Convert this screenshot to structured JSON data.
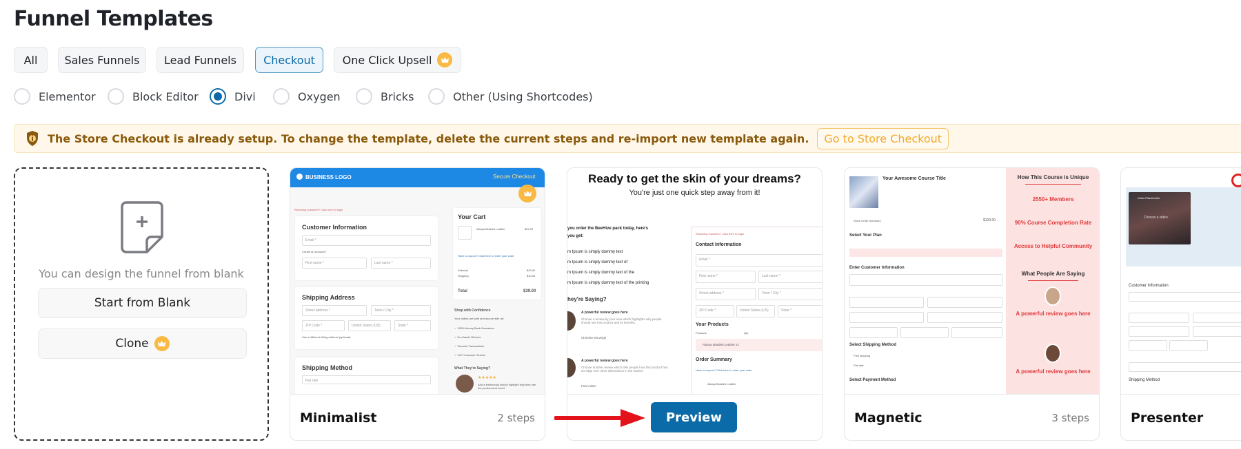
{
  "page_title": "Funnel Templates",
  "tabs": [
    {
      "label": "All"
    },
    {
      "label": "Sales Funnels"
    },
    {
      "label": "Lead Funnels"
    },
    {
      "label": "Checkout",
      "active": true
    },
    {
      "label": "One Click Upsell",
      "pro": true
    }
  ],
  "builders": [
    {
      "label": "Elementor"
    },
    {
      "label": "Block Editor"
    },
    {
      "label": "Divi",
      "selected": true
    },
    {
      "label": "Oxygen"
    },
    {
      "label": "Bricks"
    },
    {
      "label": "Other (Using Shortcodes)"
    }
  ],
  "notice": {
    "text": "The Store Checkout is already setup. To change the template, delete the current steps and re-import new template again.",
    "button": "Go to Store Checkout",
    "icon": "shield-info-icon"
  },
  "blank": {
    "text": "You can design the funnel from blank",
    "start": "Start from Blank",
    "clone": "Clone"
  },
  "colors": {
    "accent": "#0b6ba8",
    "pro": "#f9b942",
    "notice_bg": "#fff8ea",
    "arrow": "#e3121b"
  },
  "templates": [
    {
      "name": "Minimalist",
      "steps": "2 steps",
      "thumb": {
        "logo": "BUSINESS LOGO",
        "secure": "Secure Checkout",
        "returning": "Returning customer? Click here to login",
        "customer": "Customer Information",
        "email": "Email *",
        "create": "Create an account?",
        "first": "First name *",
        "last": "Last name *",
        "shipping": "Shipping Address",
        "street": "Street address *",
        "town": "Town / City *",
        "zip": "ZIP Code *",
        "country": "United States (US)",
        "state": "State *",
        "billing": "Use a different billing address (optional)",
        "method": "Shipping Method",
        "flat": "Flat rate",
        "flat_price": "$10.00",
        "cart": "Your Cart",
        "item": "Alanya Braided Leather",
        "item_price": "$29.00",
        "coupon": "Have a coupon? Click here to enter your code",
        "subtotal": "Subtotal",
        "subtotal_v": "$29.00",
        "ship": "Shipping",
        "ship_v": "$10.00",
        "total": "Total",
        "total_v": "$39.00",
        "confidence": "Shop with Confidence",
        "safe": "Your orders are safe and secure with us!",
        "checks": [
          "100% Money Back Guarantee",
          "No-Hassle Returns",
          "Secured Transactions",
          "24/7 Customer Service"
        ],
        "saying": "What They're Saying?",
        "testimonial": "Add a testimonial should highlight why they use the product and how it"
      }
    },
    {
      "name": "",
      "steps": "",
      "preview": "Preview",
      "thumb": {
        "headline": "Ready to get the skin of your dreams?",
        "sub": "You're just one quick step away from it!",
        "intro": "you order the BeeHive pack today, here's",
        "intro2": "you get:",
        "items": [
          "m Ipsum is simply dummy text",
          "m Ipsum is simply dummy text of",
          "m Ipsum is simply dummy text of the",
          "m Ipsum is simply dummy text of the printing"
        ],
        "saying": "hey're Saying?",
        "reviews": [
          {
            "title": "A powerful review goes here",
            "body": "Choose a review by your user which highlights why people should use this product and its benefits.",
            "author": "Christine McVeigh"
          },
          {
            "title": "A powerful review goes here",
            "body": "Choose another review which tells people how this product has an edge over other alternatives in the market.",
            "author": "Paul Adam"
          }
        ],
        "returning": "Returning customer? Click here to login",
        "contact": "Contact Information",
        "email": "Email *",
        "first": "First name *",
        "last": "Last name *",
        "street": "Street address *",
        "town": "Town / City *",
        "zip": "ZIP Code *",
        "country": "United States (US)",
        "state": "State *",
        "products": "Your Products",
        "col_product": "Products",
        "col_qty": "Qty",
        "product": "Alanya Braided Leather x1",
        "summary": "Order Summary",
        "coupon": "Have a coupon? Click here to enter your code",
        "summary_item": "Alanya Braided Leather"
      }
    },
    {
      "name": "Magnetic",
      "steps": "3 steps",
      "thumb": {
        "title": "Your Awesome Course Title",
        "summary": "Show Order Summary",
        "price": "$120.00",
        "plan": "Select Your Plan",
        "customer": "Enter Customer Information",
        "shipping": "Select Shipping Method",
        "free": "Free shipping",
        "flat": "Flat rate",
        "payment": "Select Payment Method",
        "unique": "How This Course is Unique",
        "members": "2550+ Members",
        "completion": "90% Course Completion Rate",
        "community": "Access to Helpful Community",
        "people": "What People Are Saying",
        "review": "A powerful review goes here"
      }
    },
    {
      "name": "Presenter",
      "steps": "",
      "thumb": {
        "video": "Video Placeholder",
        "choose": "Choose a video",
        "customer": "Customer Information",
        "shipping": "Shipping Method"
      }
    }
  ]
}
